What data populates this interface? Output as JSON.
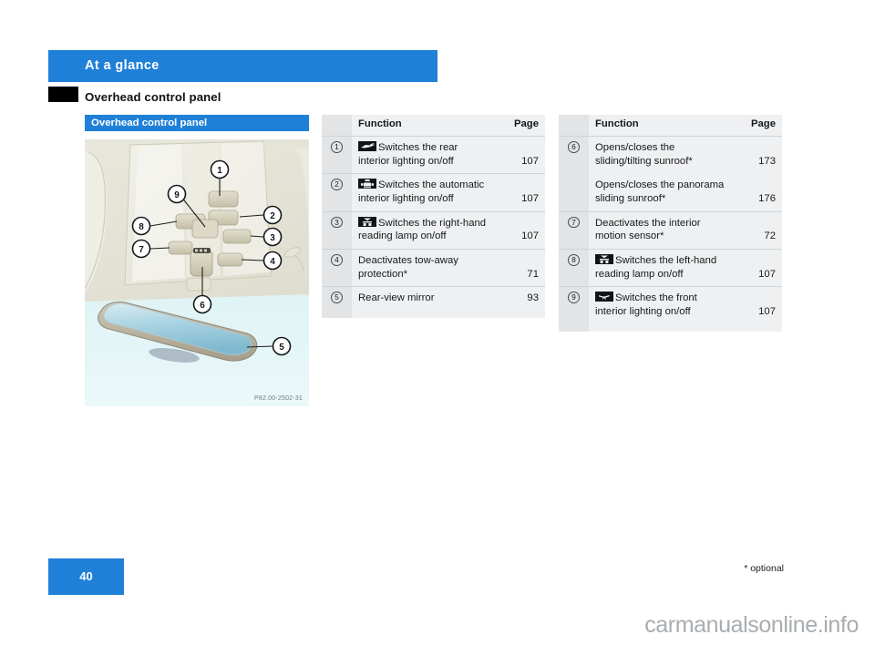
{
  "header": {
    "chapter": "At a glance",
    "section_title": "Overhead control panel",
    "accent_color": "#1f80d8",
    "tab_color": "#000000"
  },
  "figure": {
    "caption": "Overhead control panel",
    "code": "P82.00-2502-31",
    "callouts": [
      "1",
      "2",
      "3",
      "4",
      "5",
      "6",
      "7",
      "8",
      "9"
    ]
  },
  "tables": [
    {
      "name": "left-table",
      "columns": {
        "num": "",
        "function": "Function",
        "page": "Page"
      },
      "rows": [
        {
          "num": "1",
          "icon": "rear-interior-lighting-icon",
          "text": "Switches the rear interior lighting on/off",
          "page": "107"
        },
        {
          "num": "2",
          "icon": "automatic-interior-lighting-icon",
          "text": "Switches the automatic interior lighting on/off",
          "page": "107"
        },
        {
          "num": "3",
          "icon": "right-reading-lamp-icon",
          "text": "Switches the right-hand reading lamp on/off",
          "page": "107"
        },
        {
          "num": "4",
          "icon": "",
          "text": "Deactivates tow-away protection*",
          "page": "71"
        },
        {
          "num": "5",
          "icon": "",
          "text": "Rear-view mirror",
          "page": "93"
        }
      ]
    },
    {
      "name": "right-table",
      "columns": {
        "num": "",
        "function": "Function",
        "page": "Page"
      },
      "rows": [
        {
          "num": "6",
          "icon": "",
          "text": "Opens/closes the sliding/tilting sunroof*",
          "page": "173"
        },
        {
          "num": "",
          "icon": "",
          "text": "Opens/closes the panorama sliding sunroof*",
          "page": "176"
        },
        {
          "num": "7",
          "icon": "",
          "text": "Deactivates the interior motion sensor*",
          "page": "72"
        },
        {
          "num": "8",
          "icon": "left-reading-lamp-icon",
          "text": "Switches the left-hand reading lamp on/off",
          "page": "107"
        },
        {
          "num": "9",
          "icon": "front-interior-lighting-icon",
          "text": "Switches the front interior lighting on/off",
          "page": "107"
        }
      ]
    }
  ],
  "footer": {
    "page_number": "40",
    "footnote": "* optional",
    "watermark": "carmanualsonline.info"
  }
}
